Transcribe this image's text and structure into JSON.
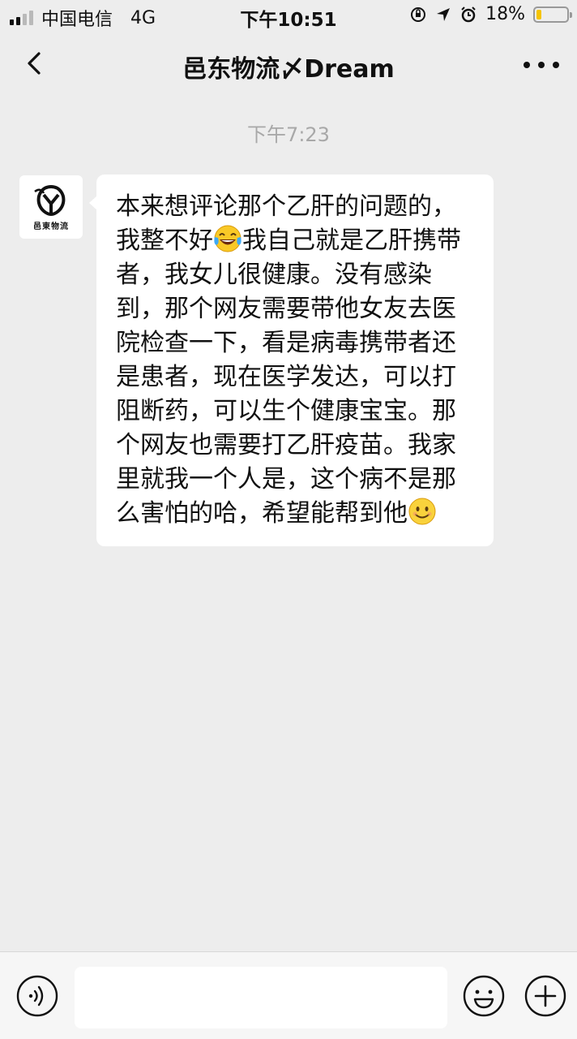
{
  "status_bar": {
    "carrier": "中国电信",
    "network": "4G",
    "time": "下午10:51",
    "battery": "18%",
    "battery_level": 0.18,
    "battery_color": "#f5c400"
  },
  "nav": {
    "title": "邑东物流〆Dream",
    "back_icon": "chevron-left-icon",
    "more_icon": "more-dots-icon"
  },
  "chat": {
    "timestamp": "下午7:23",
    "avatar_caption": "邑東物流",
    "message": {
      "part1": "本来想评论那个乙肝的问题的，我整不好",
      "emoji1": "tears-of-joy",
      "part2": "我自己就是乙肝携带者，我女儿很健康。没有感染到，那个网友需要带他女友去医院检查一下，看是病毒携带者还是患者，现在医学发达，可以打阻断药，可以生个健康宝宝。那个网友也需要打乙肝疫苗。我家里就我一个人是，这个病不是那么害怕的哈，希望能帮到他",
      "emoji2": "smile"
    }
  },
  "input_bar": {
    "text": "",
    "voice_icon": "voice-icon",
    "emoji_icon": "emoji-icon",
    "plus_icon": "plus-icon"
  }
}
